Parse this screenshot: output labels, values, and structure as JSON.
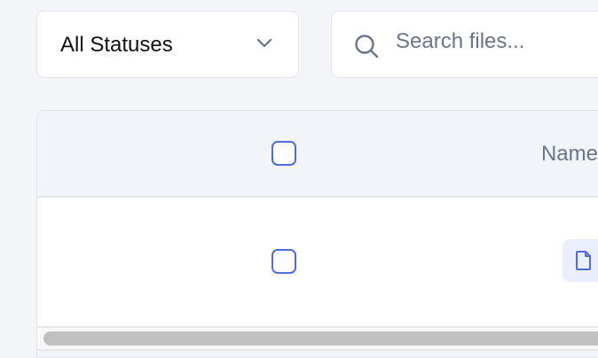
{
  "filters": {
    "status_select": {
      "value": "All Statuses",
      "icon": "chevron-down-icon"
    },
    "search": {
      "placeholder": "Search files...",
      "value": "",
      "icon": "search-icon"
    }
  },
  "table": {
    "columns": [
      {
        "type": "checkbox"
      },
      {
        "label": "Name"
      }
    ],
    "rows": [
      {
        "selected": false,
        "icon": "file-icon"
      }
    ]
  },
  "colors": {
    "accent": "#4f6bdc",
    "background": "#f3f5f9"
  }
}
